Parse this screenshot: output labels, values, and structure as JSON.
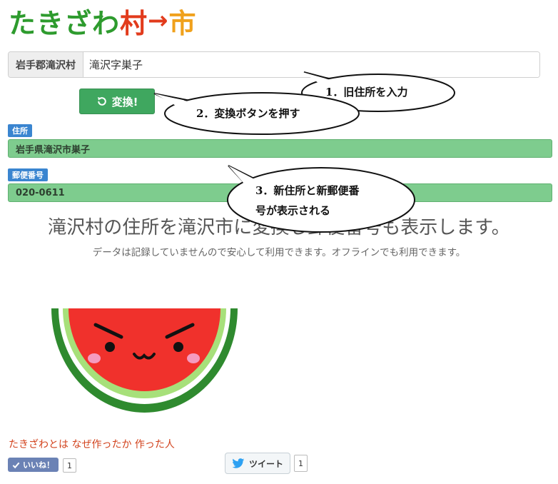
{
  "logo": {
    "part1": "たきざわ",
    "part2": "村",
    "arrow": "→",
    "part3": "市"
  },
  "address_input": {
    "prefix": "岩手郡滝沢村",
    "value": "滝沢字巣子"
  },
  "convert_button": {
    "label": "変換!"
  },
  "result_address": {
    "label": "住所",
    "value": "岩手県滝沢市巣子"
  },
  "result_postal": {
    "label": "郵便番号",
    "value": "020-0611"
  },
  "headline": "滝沢村の住所を滝沢市に変換し郵便番号も表示します。",
  "subline": "データは記録していませんので安心して利用できます。オフラインでも利用できます。",
  "footer": {
    "link1": "たきざわとは",
    "link2": "なぜ作ったか",
    "link3": "作った人"
  },
  "like": {
    "label": "いいね！",
    "count": "1"
  },
  "tweet": {
    "label": "ツイート",
    "count": "1"
  },
  "bubbles": [
    {
      "text": "1．旧住所を入力"
    },
    {
      "text": "2．変換ボタンを押す"
    },
    {
      "line1": "3．新住所と新郵便番",
      "line2": "号が表示される"
    }
  ],
  "colors": {
    "green_button": "#3fa75f",
    "result_green": "#7ecc8e",
    "label_blue": "#3a85d0",
    "link_red": "#d2421c"
  },
  "icons": [
    "refresh-icon",
    "check-icon",
    "twitter-bird-icon",
    "watermelon-mascot"
  ]
}
